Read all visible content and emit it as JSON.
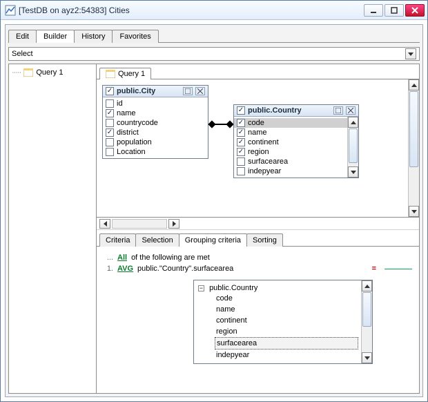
{
  "window": {
    "title": "[TestDB on ayz2:54383] Cities"
  },
  "tabs": {
    "edit": "Edit",
    "builder": "Builder",
    "history": "History",
    "favorites": "Favorites"
  },
  "select_field": "Select",
  "nav": {
    "query1": "Query 1"
  },
  "design_tab": "Query 1",
  "tables": {
    "city": {
      "title": "public.City",
      "rows": [
        {
          "label": "id",
          "checked": false
        },
        {
          "label": "name",
          "checked": true
        },
        {
          "label": "countrycode",
          "checked": false
        },
        {
          "label": "district",
          "checked": true
        },
        {
          "label": "population",
          "checked": false
        },
        {
          "label": "Location",
          "checked": false
        }
      ]
    },
    "country": {
      "title": "public.Country",
      "rows": [
        {
          "label": "code",
          "checked": true,
          "selected": true
        },
        {
          "label": "name",
          "checked": true
        },
        {
          "label": "continent",
          "checked": true
        },
        {
          "label": "region",
          "checked": true
        },
        {
          "label": "surfacearea",
          "checked": false
        },
        {
          "label": "indepyear",
          "checked": false
        }
      ]
    }
  },
  "criteria": {
    "tabs": {
      "criteria": "Criteria",
      "selection": "Selection",
      "grouping": "Grouping criteria",
      "sorting": "Sorting"
    },
    "line_ellipsis": "...",
    "all_kw": "All",
    "all_rest": "of the following are met",
    "num1": "1.",
    "agg": "AVG",
    "expr": "public.\"Country\".surfacearea",
    "eq": "="
  },
  "popup": {
    "root": "public.Country",
    "items": [
      "code",
      "name",
      "continent",
      "region",
      "surfacearea",
      "indepyear"
    ],
    "selected_index": 4
  }
}
